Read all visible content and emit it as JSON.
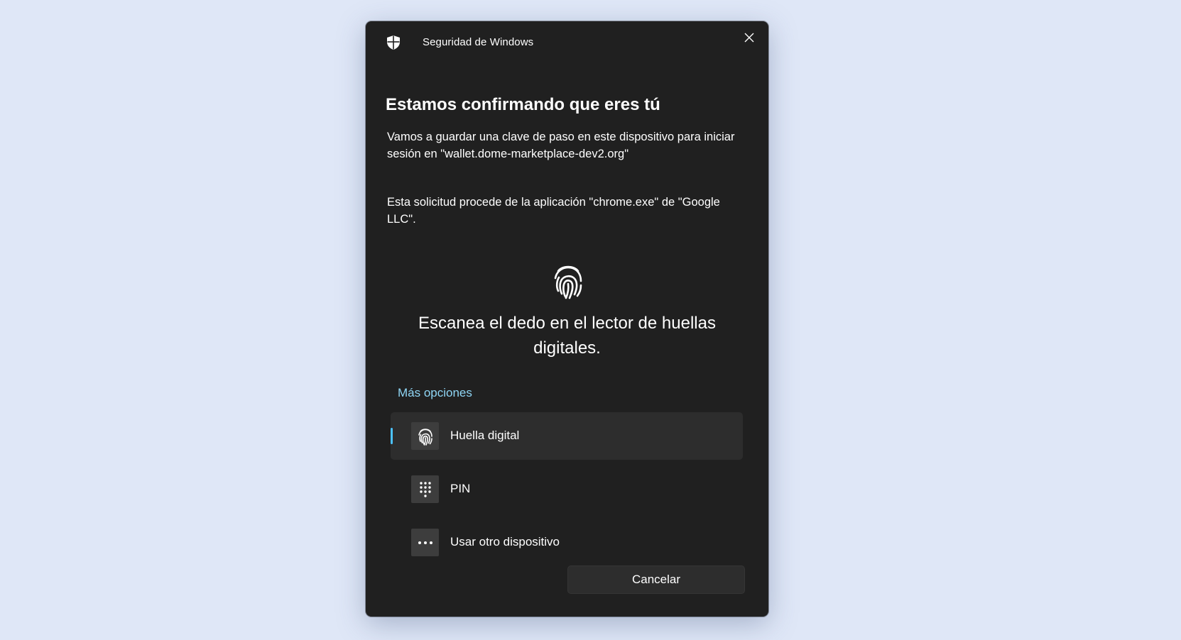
{
  "window": {
    "app_title": "Seguridad de Windows",
    "app_icon": "shield-icon",
    "close_icon": "close-icon"
  },
  "content": {
    "heading": "Estamos confirmando que eres tú",
    "message_passkey": "Vamos a guardar una clave de paso en este dispositivo para iniciar sesión en \"wallet.dome-marketplace-dev2.org\"",
    "message_source": "Esta solicitud procede de la aplicación \"chrome.exe\" de \"Google LLC\".",
    "scan_icon": "fingerprint-icon",
    "scan_instruction": "Escanea el dedo en el lector de huellas digitales."
  },
  "options": {
    "toggle_label": "Más opciones",
    "items": [
      {
        "label": "Huella digital",
        "icon": "fingerprint-icon",
        "selected": true
      },
      {
        "label": "PIN",
        "icon": "keypad-icon",
        "selected": false
      },
      {
        "label": "Usar otro dispositivo",
        "icon": "more-icon",
        "selected": false
      }
    ]
  },
  "footer": {
    "cancel_label": "Cancelar"
  },
  "colors": {
    "background": "#dfe7f7",
    "dialog": "#202020",
    "accent_link": "#8fd6f5",
    "selection_indicator": "#4cc2ff"
  }
}
